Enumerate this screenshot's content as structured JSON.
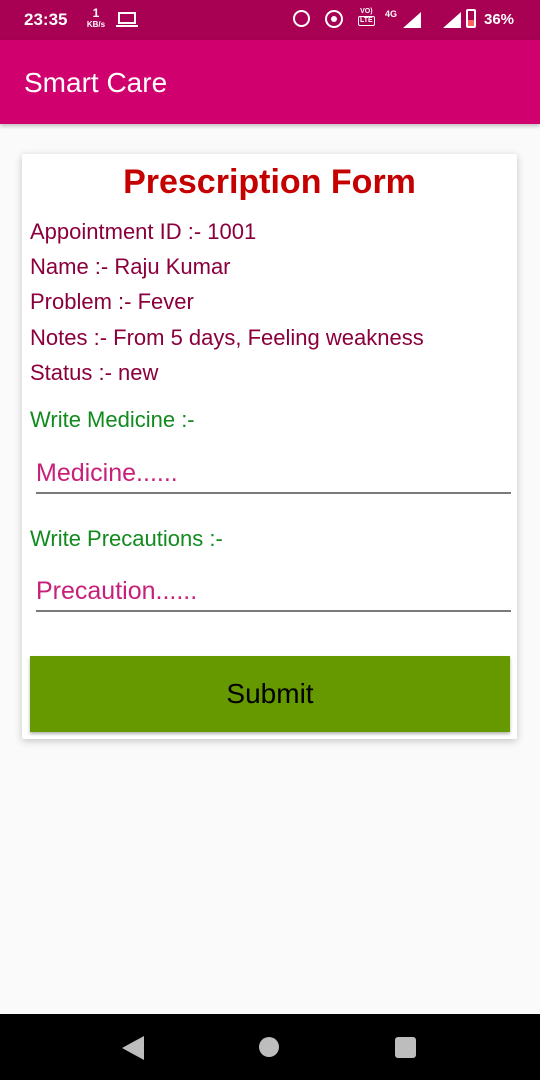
{
  "status_bar": {
    "time": "23:35",
    "net_speed_value": "1",
    "net_speed_unit": "KB/s",
    "volte_top": "VO)",
    "volte_bottom": "LTE",
    "network_type": "4G",
    "battery_percent": "36%",
    "icons": [
      "laptop-icon",
      "alarm-icon",
      "hotspot-icon",
      "volte-icon",
      "signal-icon",
      "battery-icon"
    ]
  },
  "app_bar": {
    "title": "Smart Care",
    "color": "#d0006f"
  },
  "form": {
    "title": "Prescription Form",
    "appointment": "Appointment ID :- 1001",
    "name": "Name :- Raju Kumar",
    "problem": "Problem :- Fever",
    "notes": "Notes :- From 5 days, Feeling weakness",
    "status": "Status :- new",
    "medicine_label": "Write Medicine :-",
    "medicine_placeholder": "Medicine......",
    "medicine_value": "",
    "precaution_label": "Write Precautions :-",
    "precaution_placeholder": "Precaution......",
    "precaution_value": "",
    "submit_label": "Submit",
    "submit_color": "#669900",
    "title_color": "#c40000",
    "info_color": "#8b003c",
    "label_color": "#118a1e"
  },
  "nav_bar": {
    "icons": [
      "back-icon",
      "home-icon",
      "recents-icon"
    ]
  }
}
